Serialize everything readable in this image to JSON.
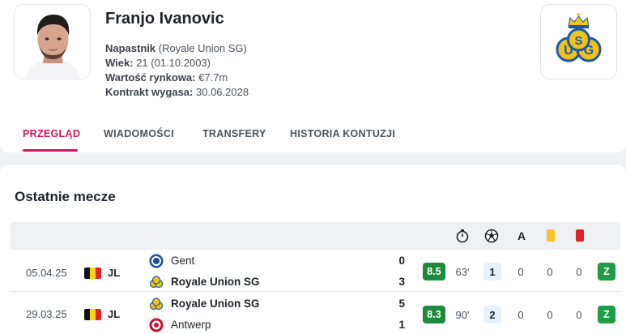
{
  "player": {
    "name": "Franjo Ivanovic",
    "position_label": "Napastnik",
    "club_paren": "(Royale Union SG)",
    "age_label": "Wiek:",
    "age_value": "21 (01.10.2003)",
    "value_label": "Wartość rynkowa:",
    "value_value": "€7.7m",
    "contract_label": "Kontrakt wygasa:",
    "contract_value": "30.06.2028"
  },
  "club_logo_text": "USG",
  "tabs": [
    {
      "label": "PRZEGLĄD",
      "active": true
    },
    {
      "label": "WIADOMOŚCI",
      "active": false
    },
    {
      "label": "TRANSFERY",
      "active": false
    },
    {
      "label": "HISTORIA KONTUZJI",
      "active": false
    }
  ],
  "recent_matches": {
    "title": "Ostatnie mecze",
    "columns": [
      {
        "icon": "stopwatch-icon"
      },
      {
        "icon": "football-icon"
      },
      {
        "icon": "assist-icon",
        "text": "A"
      },
      {
        "icon": "yellow-card-icon"
      },
      {
        "icon": "red-card-icon"
      }
    ],
    "matches": [
      {
        "date": "05.04.25",
        "league": "JL",
        "home_team": "Gent",
        "away_team": "Royale Union SG",
        "home_score": "0",
        "away_score": "3",
        "rating": "8.5",
        "minutes": "63'",
        "goals": "1",
        "assists": "0",
        "yellow": "0",
        "red": "0",
        "result": "Z"
      },
      {
        "date": "29.03.25",
        "league": "JL",
        "home_team": "Royale Union SG",
        "away_team": "Antwerp",
        "home_score": "5",
        "away_score": "1",
        "rating": "8.3",
        "minutes": "90'",
        "goals": "2",
        "assists": "0",
        "yellow": "0",
        "red": "0",
        "result": "Z"
      }
    ]
  },
  "colors": {
    "accent": "#d6145f",
    "rating_bg": "#1f8a3b",
    "win_bg": "#1f9d44",
    "yellow_card": "#f7c325",
    "red_card": "#e0202a",
    "belgium_flag": [
      "#111111",
      "#f7d417",
      "#e4222c"
    ]
  }
}
